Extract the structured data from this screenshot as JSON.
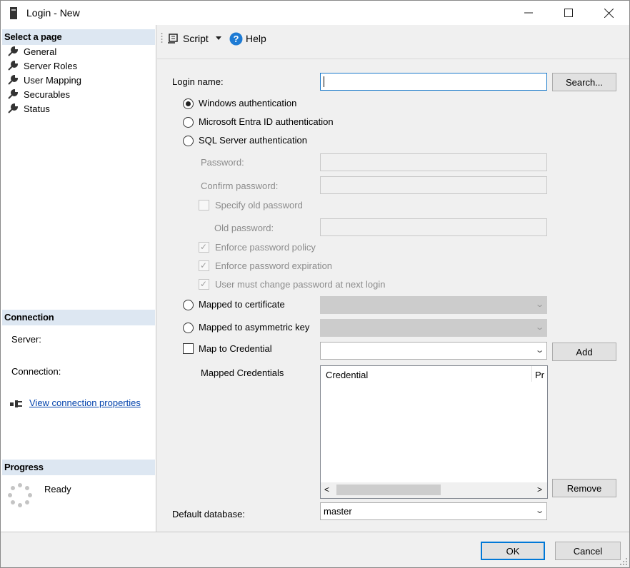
{
  "window": {
    "title": "Login - New"
  },
  "left": {
    "select_page": "Select a page",
    "pages": [
      "General",
      "Server Roles",
      "User Mapping",
      "Securables",
      "Status"
    ],
    "connection_head": "Connection",
    "server_label": "Server:",
    "connection_label": "Connection:",
    "view_props": "View connection properties",
    "progress_head": "Progress",
    "progress_status": "Ready"
  },
  "toolbar": {
    "script": "Script",
    "help": "Help"
  },
  "form": {
    "login_name_label": "Login name:",
    "login_name_value": "",
    "search_button": "Search...",
    "auth_windows": "Windows authentication",
    "auth_entra": "Microsoft Entra ID authentication",
    "auth_sql": "SQL Server authentication",
    "password_label": "Password:",
    "confirm_password_label": "Confirm password:",
    "specify_old_password": "Specify old password",
    "old_password_label": "Old password:",
    "enforce_policy": "Enforce password policy",
    "enforce_expiration": "Enforce password expiration",
    "must_change": "User must change password at next login",
    "mapped_cert": "Mapped to certificate",
    "mapped_asym": "Mapped to asymmetric key",
    "map_credential": "Map to Credential",
    "add_button": "Add",
    "mapped_credentials_label": "Mapped Credentials",
    "grid_col_credential": "Credential",
    "grid_col_provider": "Pr",
    "remove_button": "Remove",
    "default_db_label": "Default database:",
    "default_db_value": "master"
  },
  "buttons": {
    "ok": "OK",
    "cancel": "Cancel"
  },
  "colors": {
    "section_head": "#dde7f2",
    "focus": "#1979ca",
    "link": "#0645ad",
    "help_icon": "#1e7bd4"
  }
}
